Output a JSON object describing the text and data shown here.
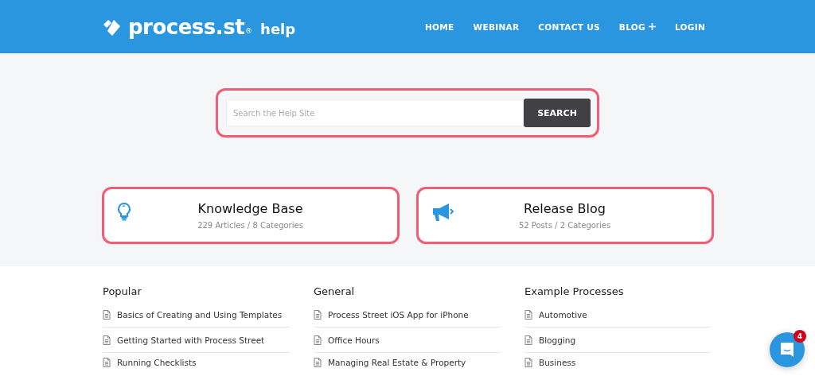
{
  "header": {
    "logo_text": "process.st",
    "logo_mark": "®",
    "logo_suffix": "help",
    "nav": [
      {
        "label": "HOME",
        "has_menu": false
      },
      {
        "label": "WEBINAR",
        "has_menu": false
      },
      {
        "label": "CONTACT US",
        "has_menu": false
      },
      {
        "label": "BLOG",
        "has_menu": true
      },
      {
        "label": "LOGIN",
        "has_menu": false
      }
    ]
  },
  "search": {
    "placeholder": "Search the Help Site",
    "button": "SEARCH"
  },
  "cards": [
    {
      "kind": "bulb",
      "title": "Knowledge Base",
      "meta": "229 Articles / 8 Categories"
    },
    {
      "kind": "megaphone",
      "title": "Release Blog",
      "meta": "52 Posts / 2 Categories"
    }
  ],
  "columns": [
    {
      "heading": "Popular",
      "items": [
        "Basics of Creating and Using Templates",
        "Getting Started with Process Street",
        "Running Checklists"
      ]
    },
    {
      "heading": "General",
      "items": [
        "Process Street iOS App for iPhone",
        "Office Hours",
        "Managing Real Estate & Property"
      ]
    },
    {
      "heading": "Example Processes",
      "items": [
        "Automotive",
        "Blogging",
        "Business"
      ]
    }
  ],
  "chat": {
    "badge": "4"
  }
}
